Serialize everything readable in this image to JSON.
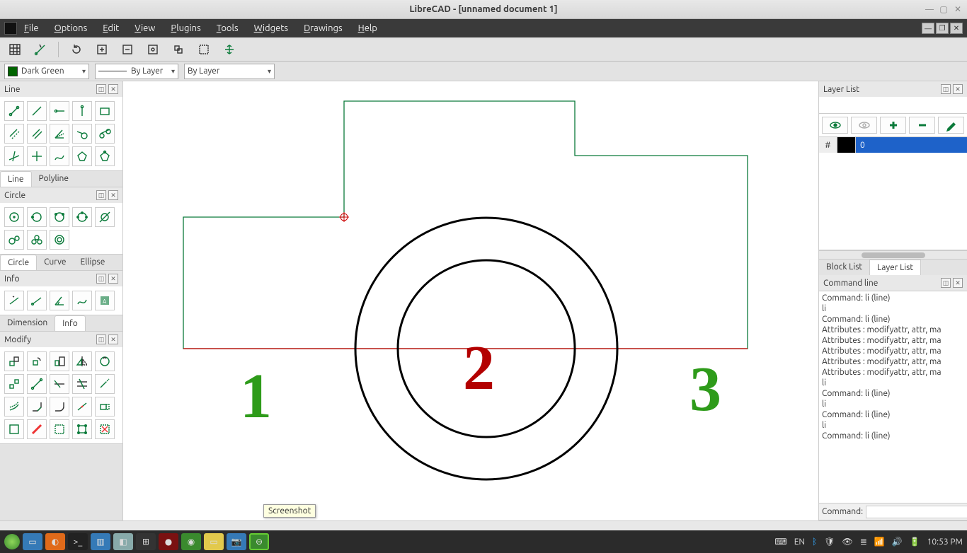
{
  "title": "LibreCAD - [unnamed document 1]",
  "menus": [
    "File",
    "Edit",
    "View",
    "Plugins",
    "Tools",
    "Widgets",
    "Drawings",
    "Help"
  ],
  "attr": {
    "color": "Dark Green",
    "linetype": "By Layer",
    "lineweight": "By Layer"
  },
  "left": {
    "line_panel": "Line",
    "line_tabs": [
      "Line",
      "Polyline"
    ],
    "circle_panel": "Circle",
    "circle_tabs": [
      "Circle",
      "Curve",
      "Ellipse"
    ],
    "info_panel": "Info",
    "dim_tabs": [
      "Dimension",
      "Info"
    ],
    "modify_panel": "Modify"
  },
  "right": {
    "layerlist_title": "Layer List",
    "layer0": "0",
    "blocklist_tab": "Block List",
    "layerlist_tab": "Layer List",
    "cmdline_title": "Command line",
    "cmdlog": [
      "Command: li (line)",
      "li",
      "Command: li (line)",
      "Attributes : modifyattr, attr, ma",
      "Attributes : modifyattr, attr, ma",
      "Attributes : modifyattr, attr, ma",
      "Attributes : modifyattr, attr, ma",
      "Attributes : modifyattr, attr, ma",
      "li",
      "Command: li (line)",
      "li",
      "Command: li (line)",
      "li",
      "Command: li (line)"
    ],
    "cmd_prompt": "Command:"
  },
  "canvas": {
    "num1": "1",
    "num2": "2",
    "num3": "3"
  },
  "tooltip": "Screenshot",
  "tray": {
    "lang": "EN",
    "time": "10:53 PM"
  }
}
